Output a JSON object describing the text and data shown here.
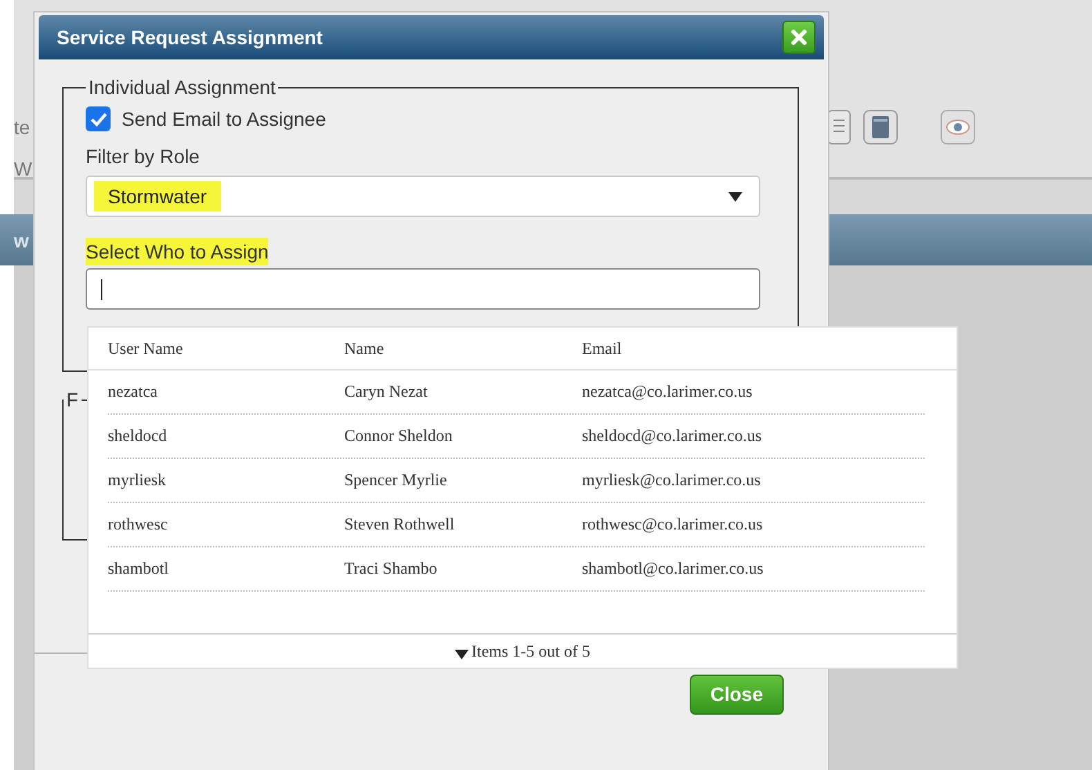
{
  "background": {
    "fragments": [
      "te",
      "W"
    ],
    "band_fragment": "w"
  },
  "dialog": {
    "title": "Service Request Assignment",
    "individual": {
      "legend": "Individual Assignment",
      "send_email": {
        "label": "Send Email to Assignee",
        "checked": true
      },
      "role": {
        "label": "Filter by Role",
        "value": "Stormwater",
        "highlighted": true
      },
      "assignee": {
        "label": "Select Who to Assign",
        "highlighted": true
      }
    },
    "second_fieldset": {
      "legend": "F"
    },
    "dropdown": {
      "columns": [
        "User Name",
        "Name",
        "Email"
      ],
      "rows": [
        [
          "nezatca",
          "Caryn Nezat",
          "nezatca@co.larimer.co.us"
        ],
        [
          "sheldocd",
          "Connor Sheldon",
          "sheldocd@co.larimer.co.us"
        ],
        [
          "myrliesk",
          "Spencer Myrlie",
          "myrliesk@co.larimer.co.us"
        ],
        [
          "rothwesc",
          "Steven Rothwell",
          "rothwesc@co.larimer.co.us"
        ],
        [
          "shambotl",
          "Traci Shambo",
          "shambotl@co.larimer.co.us"
        ]
      ],
      "pager": "Items 1-5 out of 5"
    },
    "buttons": [
      "Close"
    ]
  }
}
